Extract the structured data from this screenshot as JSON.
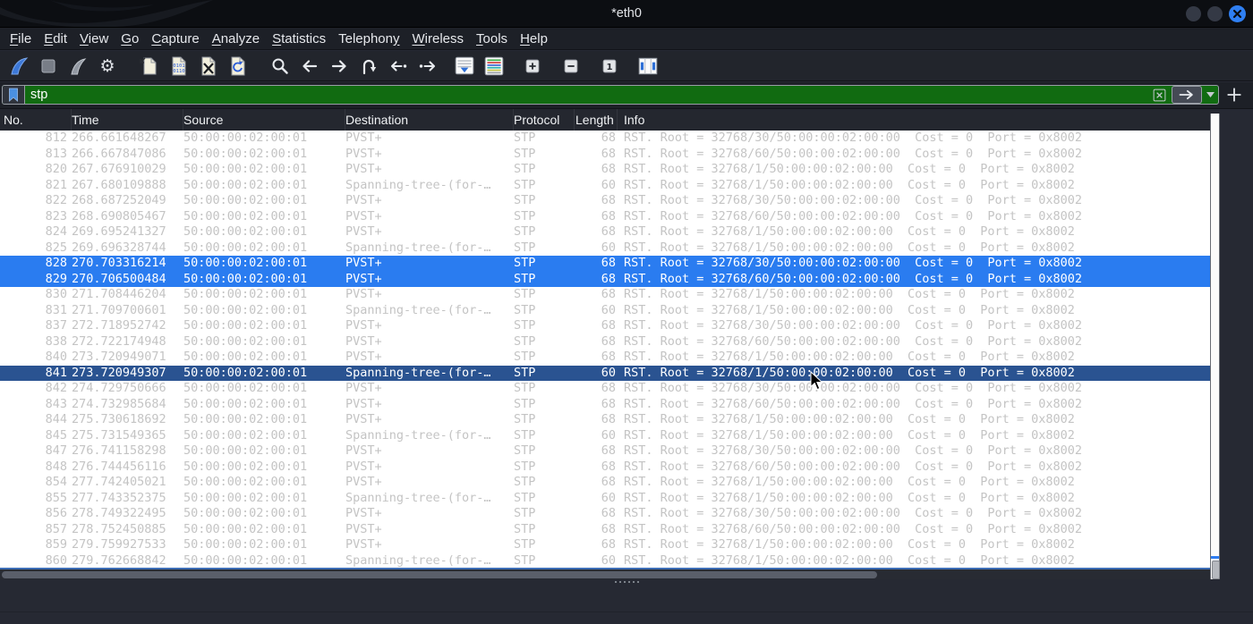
{
  "window": {
    "title": "*eth0",
    "controls": [
      "minimize",
      "maximize",
      "close"
    ]
  },
  "menu": {
    "items": [
      {
        "label": "File",
        "mnemonic": 0
      },
      {
        "label": "Edit",
        "mnemonic": 0
      },
      {
        "label": "View",
        "mnemonic": 0
      },
      {
        "label": "Go",
        "mnemonic": 0
      },
      {
        "label": "Capture",
        "mnemonic": 0
      },
      {
        "label": "Analyze",
        "mnemonic": 0
      },
      {
        "label": "Statistics",
        "mnemonic": 0
      },
      {
        "label": "Telephony",
        "mnemonic": 8
      },
      {
        "label": "Wireless",
        "mnemonic": 0
      },
      {
        "label": "Tools",
        "mnemonic": 0
      },
      {
        "label": "Help",
        "mnemonic": 0
      }
    ]
  },
  "toolbar": {
    "buttons": [
      "start-capture",
      "stop-capture",
      "restart-capture",
      "capture-options",
      "open-file",
      "save-file",
      "close-file",
      "reload-file",
      "find-packet",
      "go-back",
      "go-forward",
      "go-to-packet",
      "previous-packet",
      "next-packet",
      "auto-scroll",
      "colorize-packets",
      "zoom-in",
      "zoom-out",
      "normal-size",
      "resize-columns"
    ]
  },
  "filter": {
    "value": "stp",
    "icons": [
      "bookmark-icon",
      "clear-icon",
      "apply-arrow-icon",
      "dropdown-caret-icon",
      "add-filter-plus-icon"
    ]
  },
  "colors": {
    "filter_valid_bg": "#116b11",
    "selected_row_bg": "#2a7cf0",
    "focused_row_bg": "#2a5391",
    "row_text": "#c4c4c4",
    "accent_blue": "#2f7ff2"
  },
  "packet_table": {
    "columns": [
      "No.",
      "Time",
      "Source",
      "Destination",
      "Protocol",
      "Length",
      "Info"
    ],
    "rows": [
      {
        "no": "812",
        "time": "266.661648267",
        "source": "50:00:00:02:00:01",
        "destination": "PVST+",
        "protocol": "STP",
        "length": "68",
        "info": "RST. Root = 32768/30/50:00:00:02:00:00  Cost = 0  Port = 0x8002",
        "state": "normal"
      },
      {
        "no": "813",
        "time": "266.667847086",
        "source": "50:00:00:02:00:01",
        "destination": "PVST+",
        "protocol": "STP",
        "length": "68",
        "info": "RST. Root = 32768/60/50:00:00:02:00:00  Cost = 0  Port = 0x8002",
        "state": "normal"
      },
      {
        "no": "820",
        "time": "267.676910029",
        "source": "50:00:00:02:00:01",
        "destination": "PVST+",
        "protocol": "STP",
        "length": "68",
        "info": "RST. Root = 32768/1/50:00:00:02:00:00  Cost = 0  Port = 0x8002",
        "state": "normal"
      },
      {
        "no": "821",
        "time": "267.680109888",
        "source": "50:00:00:02:00:01",
        "destination": "Spanning-tree-(for-…",
        "protocol": "STP",
        "length": "60",
        "info": "RST. Root = 32768/1/50:00:00:02:00:00  Cost = 0  Port = 0x8002",
        "state": "normal"
      },
      {
        "no": "822",
        "time": "268.687252049",
        "source": "50:00:00:02:00:01",
        "destination": "PVST+",
        "protocol": "STP",
        "length": "68",
        "info": "RST. Root = 32768/30/50:00:00:02:00:00  Cost = 0  Port = 0x8002",
        "state": "normal"
      },
      {
        "no": "823",
        "time": "268.690805467",
        "source": "50:00:00:02:00:01",
        "destination": "PVST+",
        "protocol": "STP",
        "length": "68",
        "info": "RST. Root = 32768/60/50:00:00:02:00:00  Cost = 0  Port = 0x8002",
        "state": "normal"
      },
      {
        "no": "824",
        "time": "269.695241327",
        "source": "50:00:00:02:00:01",
        "destination": "PVST+",
        "protocol": "STP",
        "length": "68",
        "info": "RST. Root = 32768/1/50:00:00:02:00:00  Cost = 0  Port = 0x8002",
        "state": "normal"
      },
      {
        "no": "825",
        "time": "269.696328744",
        "source": "50:00:00:02:00:01",
        "destination": "Spanning-tree-(for-…",
        "protocol": "STP",
        "length": "60",
        "info": "RST. Root = 32768/1/50:00:00:02:00:00  Cost = 0  Port = 0x8002",
        "state": "normal"
      },
      {
        "no": "828",
        "time": "270.703316214",
        "source": "50:00:00:02:00:01",
        "destination": "PVST+",
        "protocol": "STP",
        "length": "68",
        "info": "RST. Root = 32768/30/50:00:00:02:00:00  Cost = 0  Port = 0x8002",
        "state": "selected"
      },
      {
        "no": "829",
        "time": "270.706500484",
        "source": "50:00:00:02:00:01",
        "destination": "PVST+",
        "protocol": "STP",
        "length": "68",
        "info": "RST. Root = 32768/60/50:00:00:02:00:00  Cost = 0  Port = 0x8002",
        "state": "selected"
      },
      {
        "no": "830",
        "time": "271.708446204",
        "source": "50:00:00:02:00:01",
        "destination": "PVST+",
        "protocol": "STP",
        "length": "68",
        "info": "RST. Root = 32768/1/50:00:00:02:00:00  Cost = 0  Port = 0x8002",
        "state": "normal"
      },
      {
        "no": "831",
        "time": "271.709700601",
        "source": "50:00:00:02:00:01",
        "destination": "Spanning-tree-(for-…",
        "protocol": "STP",
        "length": "60",
        "info": "RST. Root = 32768/1/50:00:00:02:00:00  Cost = 0  Port = 0x8002",
        "state": "normal"
      },
      {
        "no": "837",
        "time": "272.718952742",
        "source": "50:00:00:02:00:01",
        "destination": "PVST+",
        "protocol": "STP",
        "length": "68",
        "info": "RST. Root = 32768/30/50:00:00:02:00:00  Cost = 0  Port = 0x8002",
        "state": "normal"
      },
      {
        "no": "838",
        "time": "272.722174948",
        "source": "50:00:00:02:00:01",
        "destination": "PVST+",
        "protocol": "STP",
        "length": "68",
        "info": "RST. Root = 32768/60/50:00:00:02:00:00  Cost = 0  Port = 0x8002",
        "state": "normal"
      },
      {
        "no": "840",
        "time": "273.720949071",
        "source": "50:00:00:02:00:01",
        "destination": "PVST+",
        "protocol": "STP",
        "length": "68",
        "info": "RST. Root = 32768/1/50:00:00:02:00:00  Cost = 0  Port = 0x8002",
        "state": "normal"
      },
      {
        "no": "841",
        "time": "273.720949307",
        "source": "50:00:00:02:00:01",
        "destination": "Spanning-tree-(for-…",
        "protocol": "STP",
        "length": "60",
        "info": "RST. Root = 32768/1/50:00:00:02:00:00  Cost = 0  Port = 0x8002",
        "state": "focused"
      },
      {
        "no": "842",
        "time": "274.729750666",
        "source": "50:00:00:02:00:01",
        "destination": "PVST+",
        "protocol": "STP",
        "length": "68",
        "info": "RST. Root = 32768/30/50:00:00:02:00:00  Cost = 0  Port = 0x8002",
        "state": "normal"
      },
      {
        "no": "843",
        "time": "274.732985684",
        "source": "50:00:00:02:00:01",
        "destination": "PVST+",
        "protocol": "STP",
        "length": "68",
        "info": "RST. Root = 32768/60/50:00:00:02:00:00  Cost = 0  Port = 0x8002",
        "state": "normal"
      },
      {
        "no": "844",
        "time": "275.730618692",
        "source": "50:00:00:02:00:01",
        "destination": "PVST+",
        "protocol": "STP",
        "length": "68",
        "info": "RST. Root = 32768/1/50:00:00:02:00:00  Cost = 0  Port = 0x8002",
        "state": "normal"
      },
      {
        "no": "845",
        "time": "275.731549365",
        "source": "50:00:00:02:00:01",
        "destination": "Spanning-tree-(for-…",
        "protocol": "STP",
        "length": "60",
        "info": "RST. Root = 32768/1/50:00:00:02:00:00  Cost = 0  Port = 0x8002",
        "state": "normal"
      },
      {
        "no": "847",
        "time": "276.741158298",
        "source": "50:00:00:02:00:01",
        "destination": "PVST+",
        "protocol": "STP",
        "length": "68",
        "info": "RST. Root = 32768/30/50:00:00:02:00:00  Cost = 0  Port = 0x8002",
        "state": "normal"
      },
      {
        "no": "848",
        "time": "276.744456116",
        "source": "50:00:00:02:00:01",
        "destination": "PVST+",
        "protocol": "STP",
        "length": "68",
        "info": "RST. Root = 32768/60/50:00:00:02:00:00  Cost = 0  Port = 0x8002",
        "state": "normal"
      },
      {
        "no": "854",
        "time": "277.742405021",
        "source": "50:00:00:02:00:01",
        "destination": "PVST+",
        "protocol": "STP",
        "length": "68",
        "info": "RST. Root = 32768/1/50:00:00:02:00:00  Cost = 0  Port = 0x8002",
        "state": "normal"
      },
      {
        "no": "855",
        "time": "277.743352375",
        "source": "50:00:00:02:00:01",
        "destination": "Spanning-tree-(for-…",
        "protocol": "STP",
        "length": "60",
        "info": "RST. Root = 32768/1/50:00:00:02:00:00  Cost = 0  Port = 0x8002",
        "state": "normal"
      },
      {
        "no": "856",
        "time": "278.749322495",
        "source": "50:00:00:02:00:01",
        "destination": "PVST+",
        "protocol": "STP",
        "length": "68",
        "info": "RST. Root = 32768/30/50:00:00:02:00:00  Cost = 0  Port = 0x8002",
        "state": "normal"
      },
      {
        "no": "857",
        "time": "278.752450885",
        "source": "50:00:00:02:00:01",
        "destination": "PVST+",
        "protocol": "STP",
        "length": "68",
        "info": "RST. Root = 32768/60/50:00:00:02:00:00  Cost = 0  Port = 0x8002",
        "state": "normal"
      },
      {
        "no": "859",
        "time": "279.759927533",
        "source": "50:00:00:02:00:01",
        "destination": "PVST+",
        "protocol": "STP",
        "length": "68",
        "info": "RST. Root = 32768/1/50:00:00:02:00:00  Cost = 0  Port = 0x8002",
        "state": "normal"
      },
      {
        "no": "860",
        "time": "279.762668842",
        "source": "50:00:00:02:00:01",
        "destination": "Spanning-tree-(for-…",
        "protocol": "STP",
        "length": "60",
        "info": "RST. Root = 32768/1/50:00:00:02:00:00  Cost = 0  Port = 0x8002",
        "state": "normal"
      }
    ]
  }
}
